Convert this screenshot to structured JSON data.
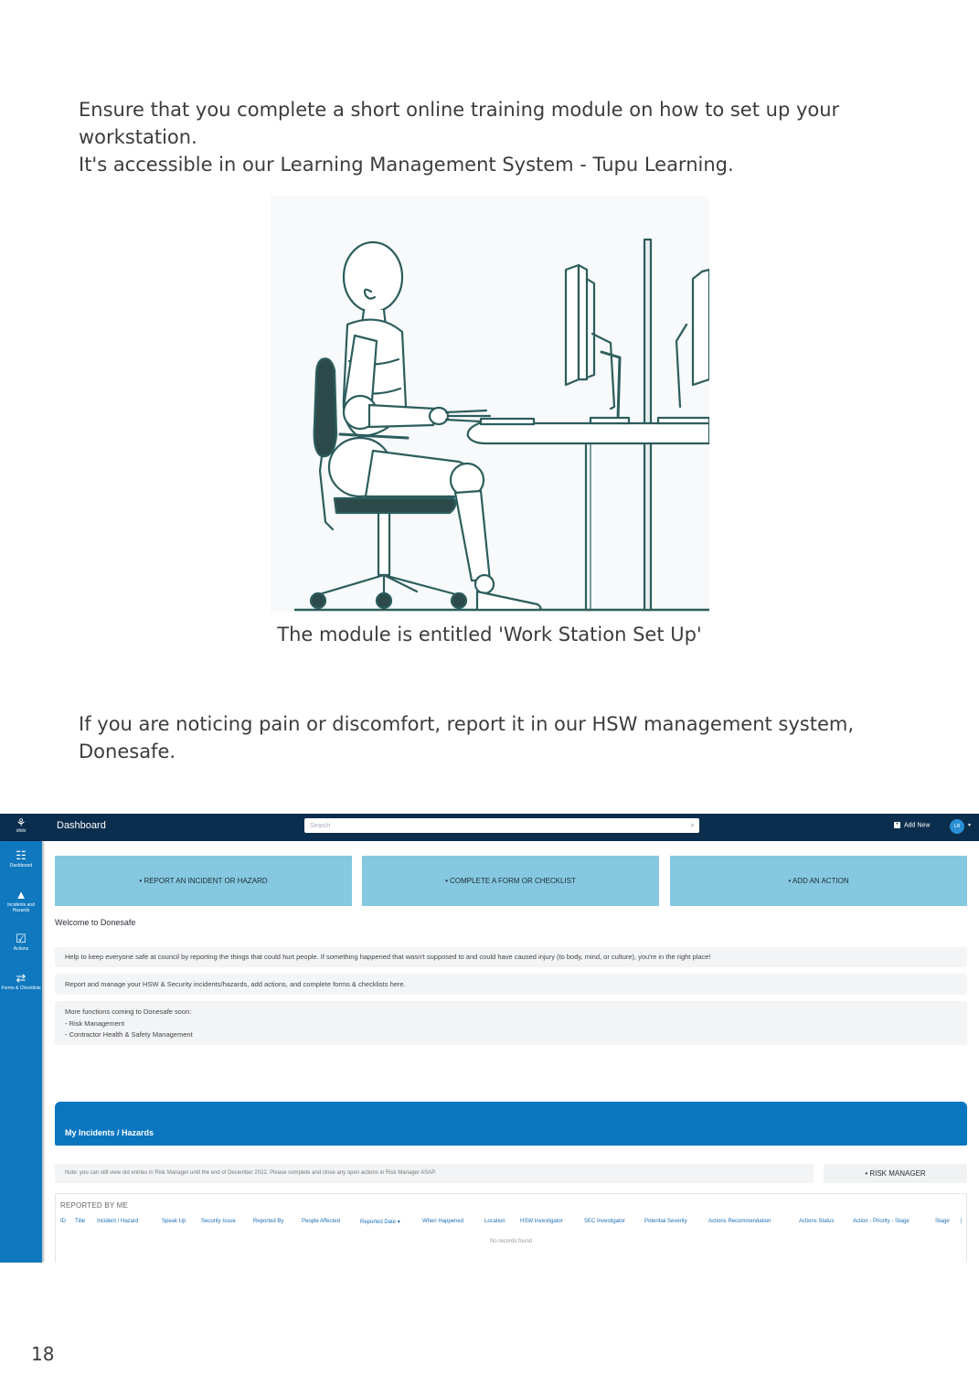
{
  "document": {
    "para1_line1": "Ensure that you complete a short online training module on how to set up your workstation.",
    "para1_line2": "It's accessible in our Learning Management System - Tupu Learning.",
    "caption": "The module is entitled 'Work Station Set Up'",
    "para2": "If you are noticing pain or discomfort, report it in our HSW management system, Donesafe.",
    "page_number": "18"
  },
  "donesafe": {
    "logo_text": "ofolo",
    "topbar_title": "Dashboard",
    "search_placeholder": "Search",
    "add_new_label": "Add New",
    "avatar_initials": "LR",
    "sidebar": [
      {
        "label": "Dashboard",
        "icon": "dashboard-icon"
      },
      {
        "label": "Incidents and Hazards",
        "icon": "warning-icon"
      },
      {
        "label": "Actions",
        "icon": "checkbox-icon"
      },
      {
        "label": "Forms & Checklists",
        "icon": "forms-icon"
      }
    ],
    "buttons": {
      "report": "• REPORT AN INCIDENT OR HAZARD",
      "form": "• COMPLETE A FORM OR CHECKLIST",
      "action": "• ADD AN ACTION"
    },
    "welcome_title": "Welcome to Donesafe",
    "info1": "Help to keep everyone safe at council by reporting the things that could hurt people. If something happened that wasn't supposed to and could have caused injury (to body, mind, or culture), you're in the right place!",
    "info2": "Report and manage your HSW & Security incidents/hazards, add actions, and complete forms & checklists here.",
    "info3": [
      "More functions coming to Donesafe soon:",
      "- Risk Management",
      "- Contractor Health & Safety Management"
    ],
    "section_title": "My Incidents / Hazards",
    "note": "Note: you can still view old entries in Risk Manager until the end of December 2022. Please complete and close any open actions in Risk Manager ASAP.",
    "risk_manager_button": "• RISK MANAGER",
    "table_title": "REPORTED BY ME",
    "table_headers": [
      "ID",
      "Title",
      "Incident / Hazard",
      "Speak Up",
      "Security Issue",
      "Reported By",
      "People Affected",
      "Reported Date ▾",
      "When Happened",
      "Location",
      "HSW Investigator",
      "SEC Investigator",
      "Potential Severity",
      "Actions Recommendation",
      "Actions Status",
      "Action - Priority - Stage",
      "Stage",
      "|"
    ],
    "empty_message": "No records found",
    "colors": {
      "topbar": "#0c2e4e",
      "sidebar": "#0f78bf",
      "action_button": "#85c8e0",
      "section_header": "#0a76c0"
    }
  }
}
